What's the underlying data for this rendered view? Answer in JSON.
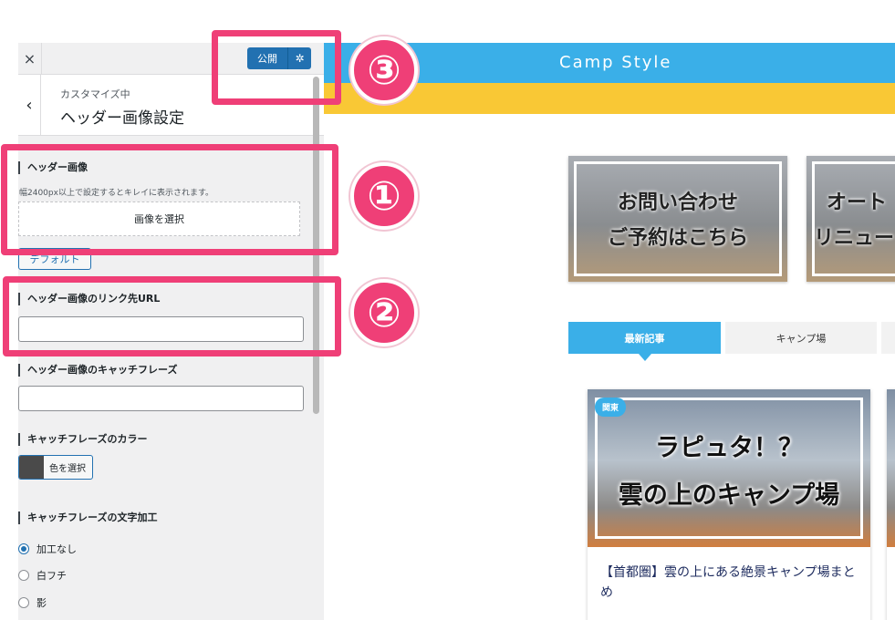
{
  "sidebar": {
    "close_icon": "×",
    "publish_label": "公開",
    "gear_icon": "✲",
    "back_icon": "‹",
    "breadcrumb": "カスタマイズ中",
    "section_title": "ヘッダー画像設定",
    "header_image": {
      "title": "ヘッダー画像",
      "description": "幅2400px以上で設定するとキレイに表示されます。",
      "select_button": "画像を選択",
      "default_button": "デフォルト"
    },
    "link_url": {
      "title": "ヘッダー画像のリンク先URL",
      "value": ""
    },
    "catchphrase": {
      "title": "ヘッダー画像のキャッチフレーズ",
      "value": ""
    },
    "catch_color": {
      "title": "キャッチフレーズのカラー",
      "button": "色を選択",
      "color": "#4a4a4a"
    },
    "text_effect": {
      "title": "キャッチフレーズの文字加工",
      "options": [
        {
          "label": "加工なし",
          "checked": true
        },
        {
          "label": "白フチ",
          "checked": false
        },
        {
          "label": "影",
          "checked": false
        }
      ]
    }
  },
  "preview": {
    "site_title": "Camp Style",
    "colors": {
      "header": "#3aafe8",
      "band": "#f9c835",
      "accent": "#ef3f77"
    },
    "banners": [
      {
        "line1": "お問い合わせ",
        "line2": "ご予約はこちら"
      },
      {
        "line1": "オート",
        "line2": "リニュー"
      }
    ],
    "tabs": [
      "最新記事",
      "キャンプ場"
    ],
    "card": {
      "tag": "関東",
      "image_line1": "ラピュタ！？",
      "image_line2": "雲の上のキャンプ場",
      "title": "【首都圏】雲の上にある絶景キャンプ場まとめ"
    }
  },
  "annotations": [
    "③",
    "①",
    "②"
  ]
}
